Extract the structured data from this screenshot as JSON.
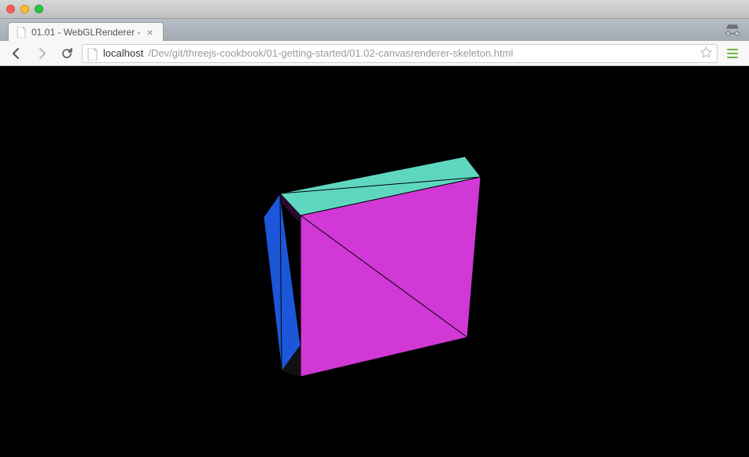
{
  "window": {
    "traffic_red": "close",
    "traffic_yellow": "minimize",
    "traffic_green": "maximize"
  },
  "tab": {
    "title": "01.01 - WebGLRenderer -",
    "close_label": "×"
  },
  "toolbar": {
    "back_label": "Back",
    "forward_label": "Forward",
    "reload_label": "Reload",
    "bookmark_label": "Bookmark",
    "menu_label": "Menu"
  },
  "url": {
    "host": "localhost",
    "path": "/Dev/git/threejs-cookbook/01-getting-started/01.02-canvasrenderer-skeleton.html"
  },
  "incognito_label": "Incognito",
  "cube": {
    "face_front_color": "#d138d6",
    "face_top_color": "#5fd7c0",
    "face_left_color": "#1b57d8",
    "edge_color": "#000000",
    "background": "#000000"
  }
}
